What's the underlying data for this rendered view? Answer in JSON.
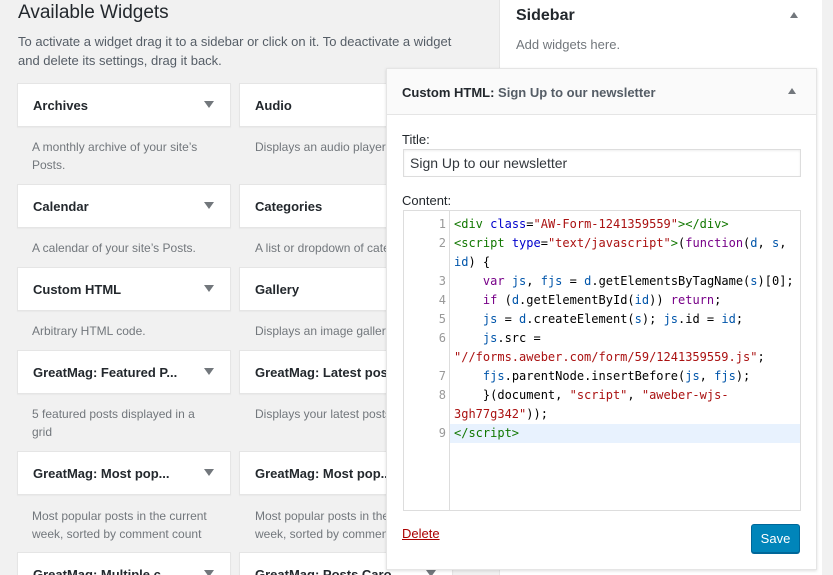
{
  "available": {
    "title": "Available Widgets",
    "description": "To activate a widget drag it to a sidebar or click on it. To deactivate a widget and delete its settings, drag it back."
  },
  "widgets": [
    {
      "title": "Archives",
      "desc": "A monthly archive of your site’s Posts."
    },
    {
      "title": "Audio",
      "desc": "Displays an audio player."
    },
    {
      "title": "Calendar",
      "desc": "A calendar of your site’s Posts."
    },
    {
      "title": "Categories",
      "desc": "A list or dropdown of categories."
    },
    {
      "title": "Custom HTML",
      "desc": "Arbitrary HTML code."
    },
    {
      "title": "Gallery",
      "desc": "Displays an image gallery."
    },
    {
      "title": "GreatMag: Featured P...",
      "desc": "5 featured posts displayed in a grid"
    },
    {
      "title": "GreatMag: Latest pos...",
      "desc": "Displays your latest posts."
    },
    {
      "title": "GreatMag: Most pop...",
      "desc": "Most popular posts in the current week, sorted by comment count"
    },
    {
      "title": "GreatMag: Most pop...",
      "desc": "Most popular posts in the current week, sorted by comment count"
    },
    {
      "title": "GreatMag: Multiple c...",
      "desc": ""
    },
    {
      "title": "GreatMag: Posts Caro...",
      "desc": ""
    }
  ],
  "sidebar": {
    "title": "Sidebar",
    "description": "Add widgets here."
  },
  "panel": {
    "title_prefix": "Custom HTML:",
    "title_suffix": " Sign Up to our newsletter",
    "title_label": "Title:",
    "title_value": "Sign Up to our newsletter",
    "content_label": "Content:",
    "delete_label": "Delete",
    "save_label": "Save"
  },
  "code_lines": [
    "1",
    "2",
    "3",
    "4",
    "5",
    "6",
    "7",
    "8",
    "9"
  ]
}
